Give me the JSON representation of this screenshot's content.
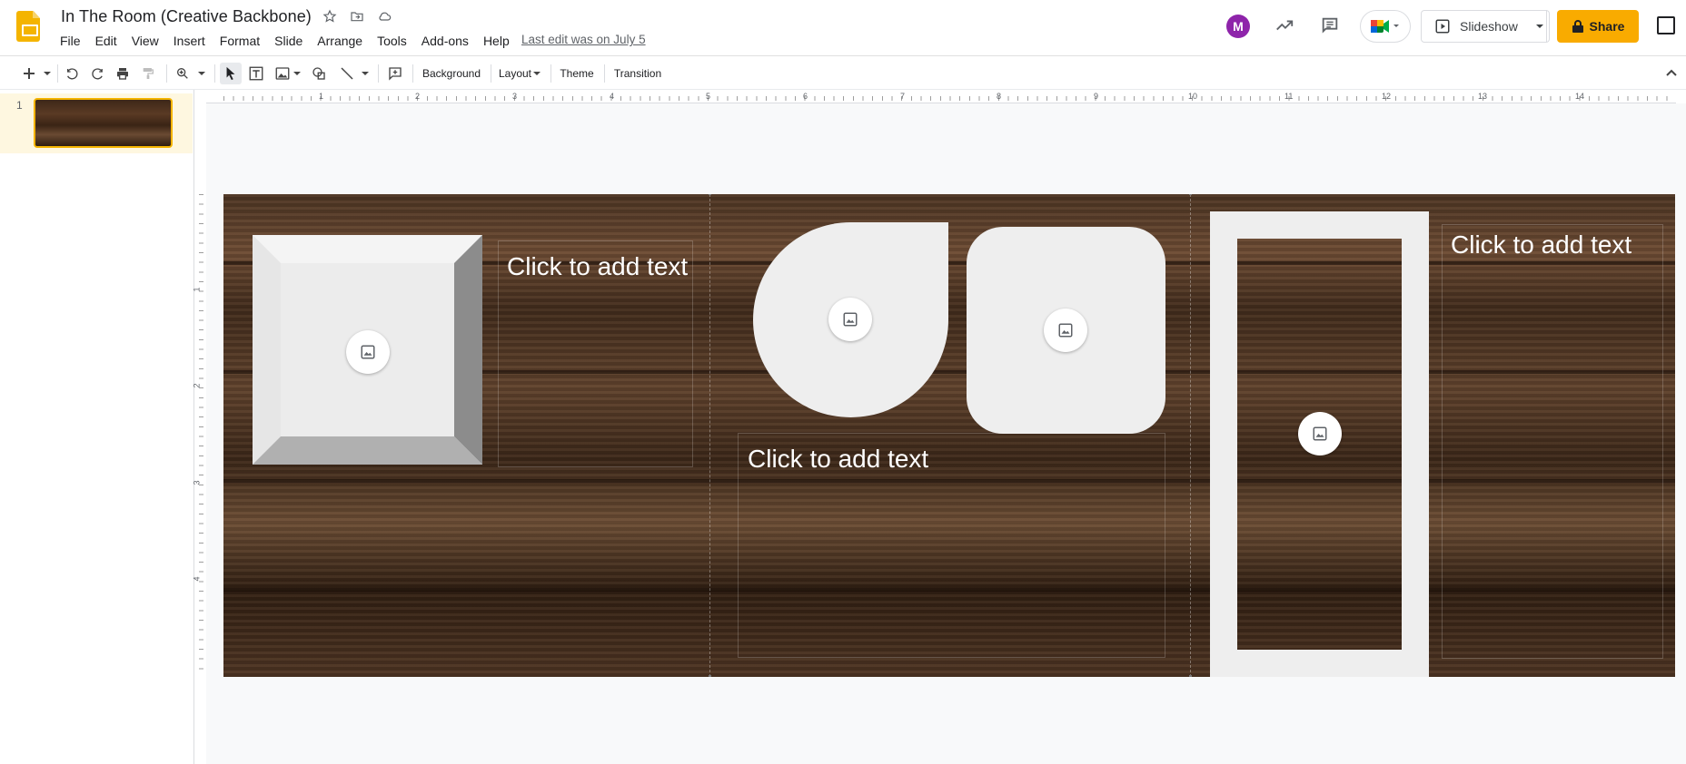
{
  "app": {
    "title": "In The Room (Creative Backbone)",
    "last_edit": "Last edit was on July 5"
  },
  "menu": [
    "File",
    "Edit",
    "View",
    "Insert",
    "Format",
    "Slide",
    "Arrange",
    "Tools",
    "Add-ons",
    "Help"
  ],
  "header": {
    "slideshow_label": "Slideshow",
    "share_label": "Share",
    "avatar_letter": "M"
  },
  "toolbar": {
    "background_label": "Background",
    "layout_label": "Layout",
    "theme_label": "Theme",
    "transition_label": "Transition"
  },
  "ruler": {
    "h_numbers": [
      "1",
      "2",
      "3",
      "4",
      "5",
      "6",
      "7",
      "8",
      "9",
      "10",
      "11",
      "12",
      "13",
      "14"
    ],
    "v_numbers": [
      "1",
      "2",
      "3",
      "4"
    ]
  },
  "filmstrip": {
    "slide_number": "1"
  },
  "slide": {
    "placeholder_1": "Click to add text",
    "placeholder_2": "Click to add text",
    "placeholder_3": "Click to add text"
  },
  "colors": {
    "accent": "#f9ab00",
    "logo": "#f4b400",
    "avatar": "#8e24aa",
    "shape_fill": "#eeeeee"
  }
}
